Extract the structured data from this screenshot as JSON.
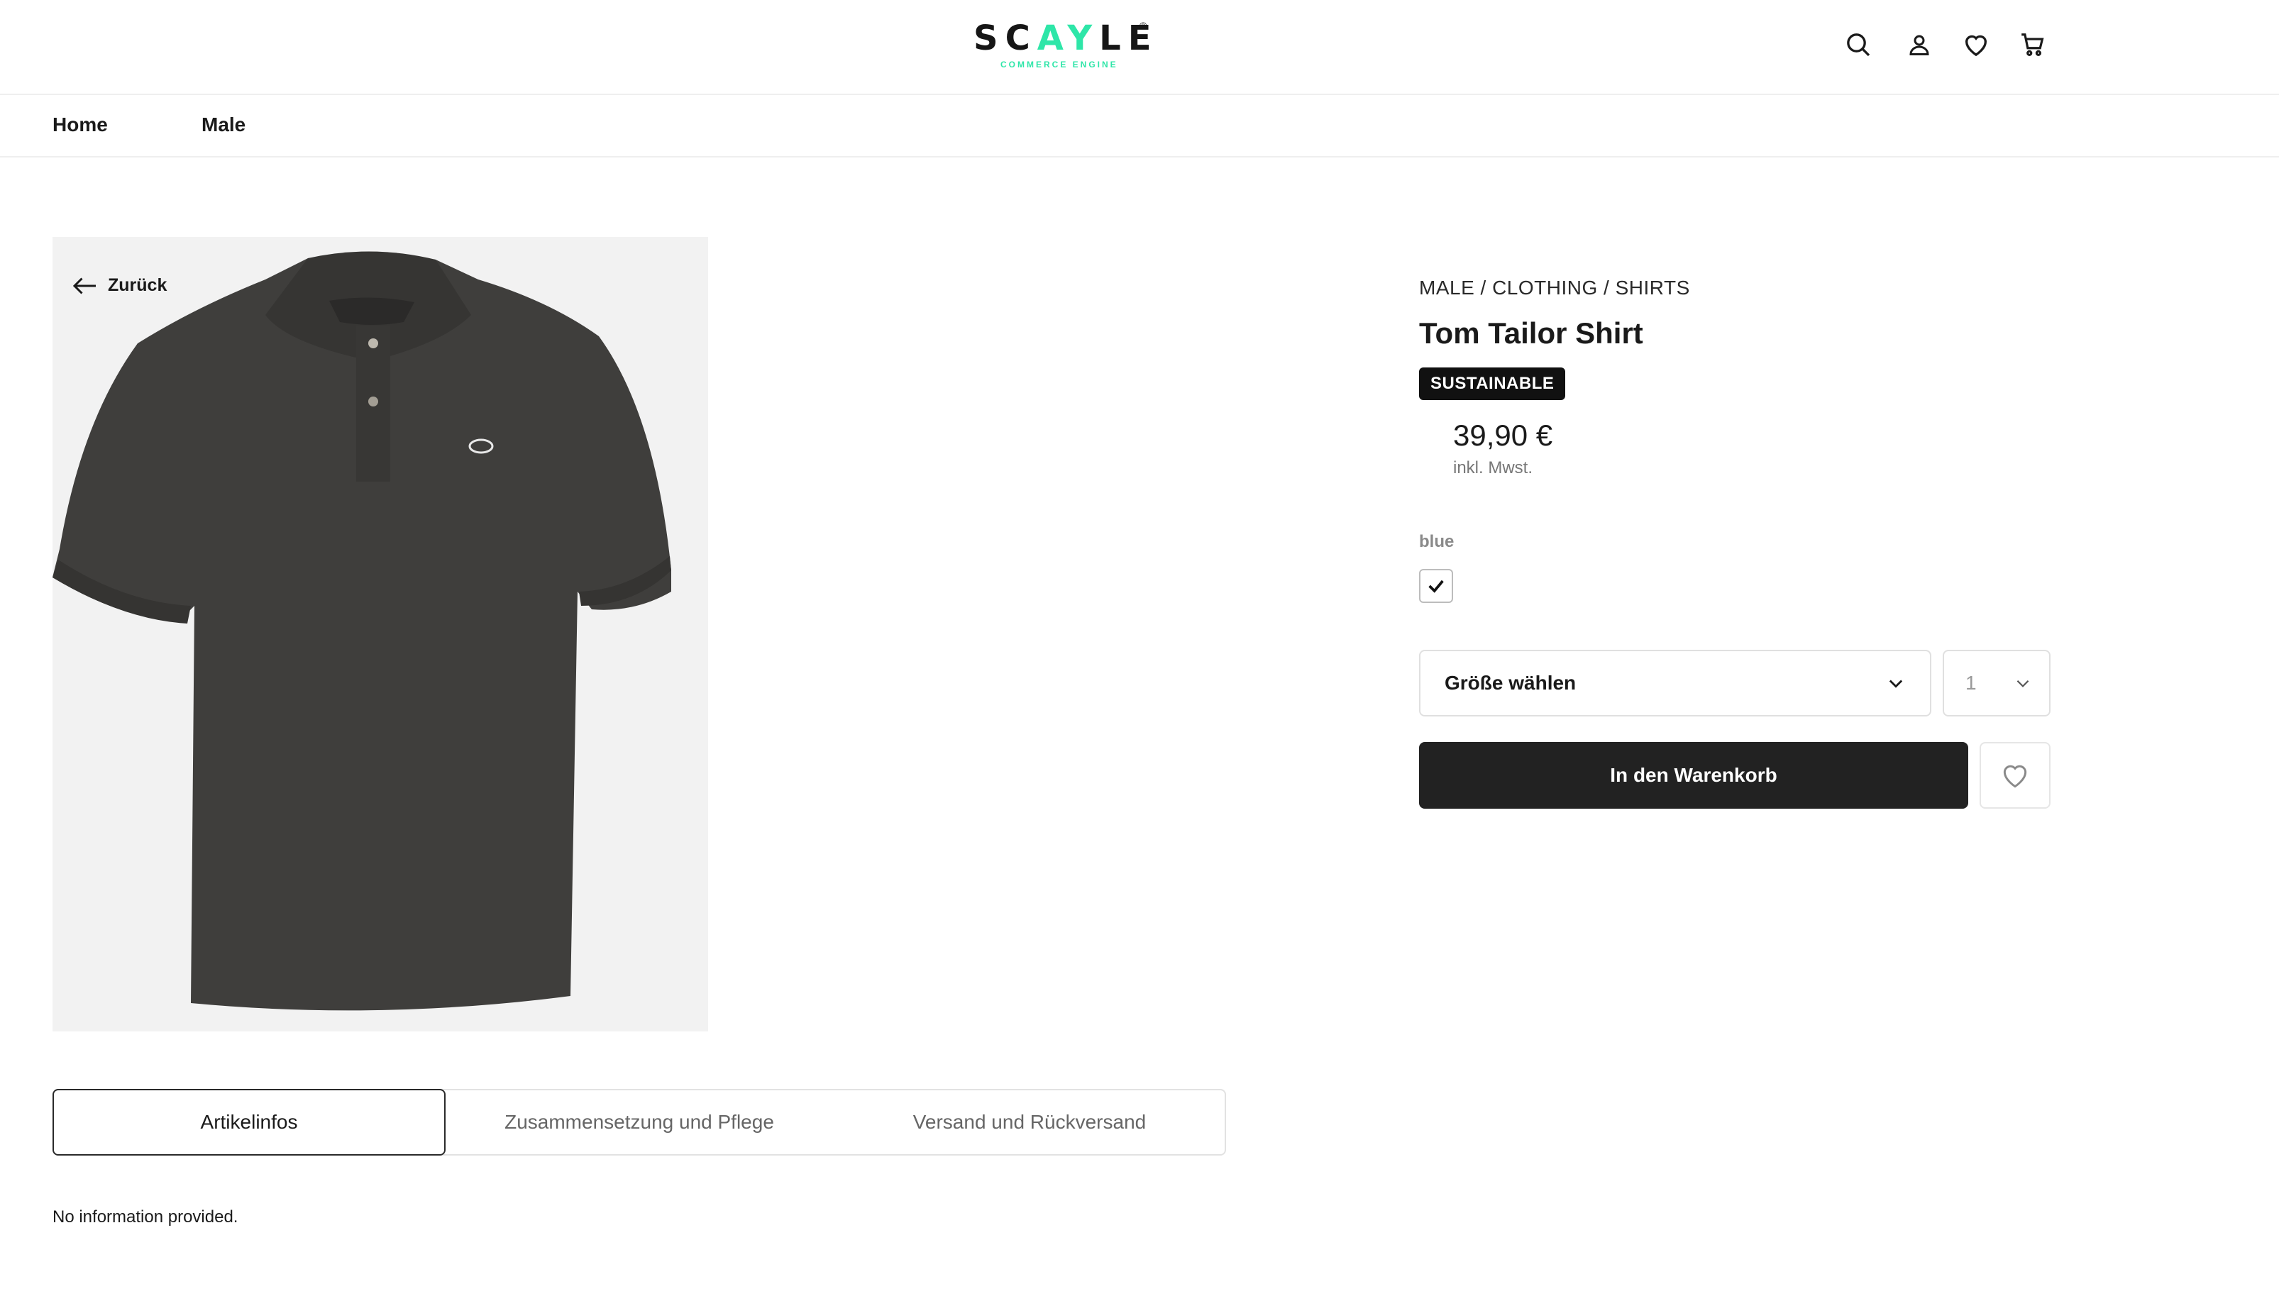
{
  "header": {
    "logo_text_1": "SC",
    "logo_text_accent": "AY",
    "logo_text_2": "LE",
    "logo_reg": "®",
    "logo_sub": "COMMERCE ENGINE",
    "icons": [
      "search-icon",
      "user-icon",
      "heart-icon",
      "cart-icon"
    ]
  },
  "nav": {
    "items": [
      {
        "label": "Home"
      },
      {
        "label": "Male"
      }
    ]
  },
  "product": {
    "back_label": "Zurück",
    "breadcrumb": "MALE / CLOTHING / SHIRTS",
    "title": "Tom Tailor Shirt",
    "badge": "SUSTAINABLE",
    "price": "39,90 €",
    "vat": "inkl. Mwst.",
    "color_label": "blue",
    "size_placeholder": "Größe wählen",
    "quantity": "1",
    "add_to_cart": "In den Warenkorb"
  },
  "tabs": [
    {
      "label": "Artikelinfos",
      "active": true
    },
    {
      "label": "Zusammensetzung und Pflege",
      "active": false
    },
    {
      "label": "Versand und Rückversand",
      "active": false
    }
  ],
  "info_text": "No information provided.",
  "colors": {
    "accent": "#2ee6a8",
    "button_dark": "#222222",
    "shirt": "#3f3e3c",
    "image_bg": "#f2f2f2"
  }
}
